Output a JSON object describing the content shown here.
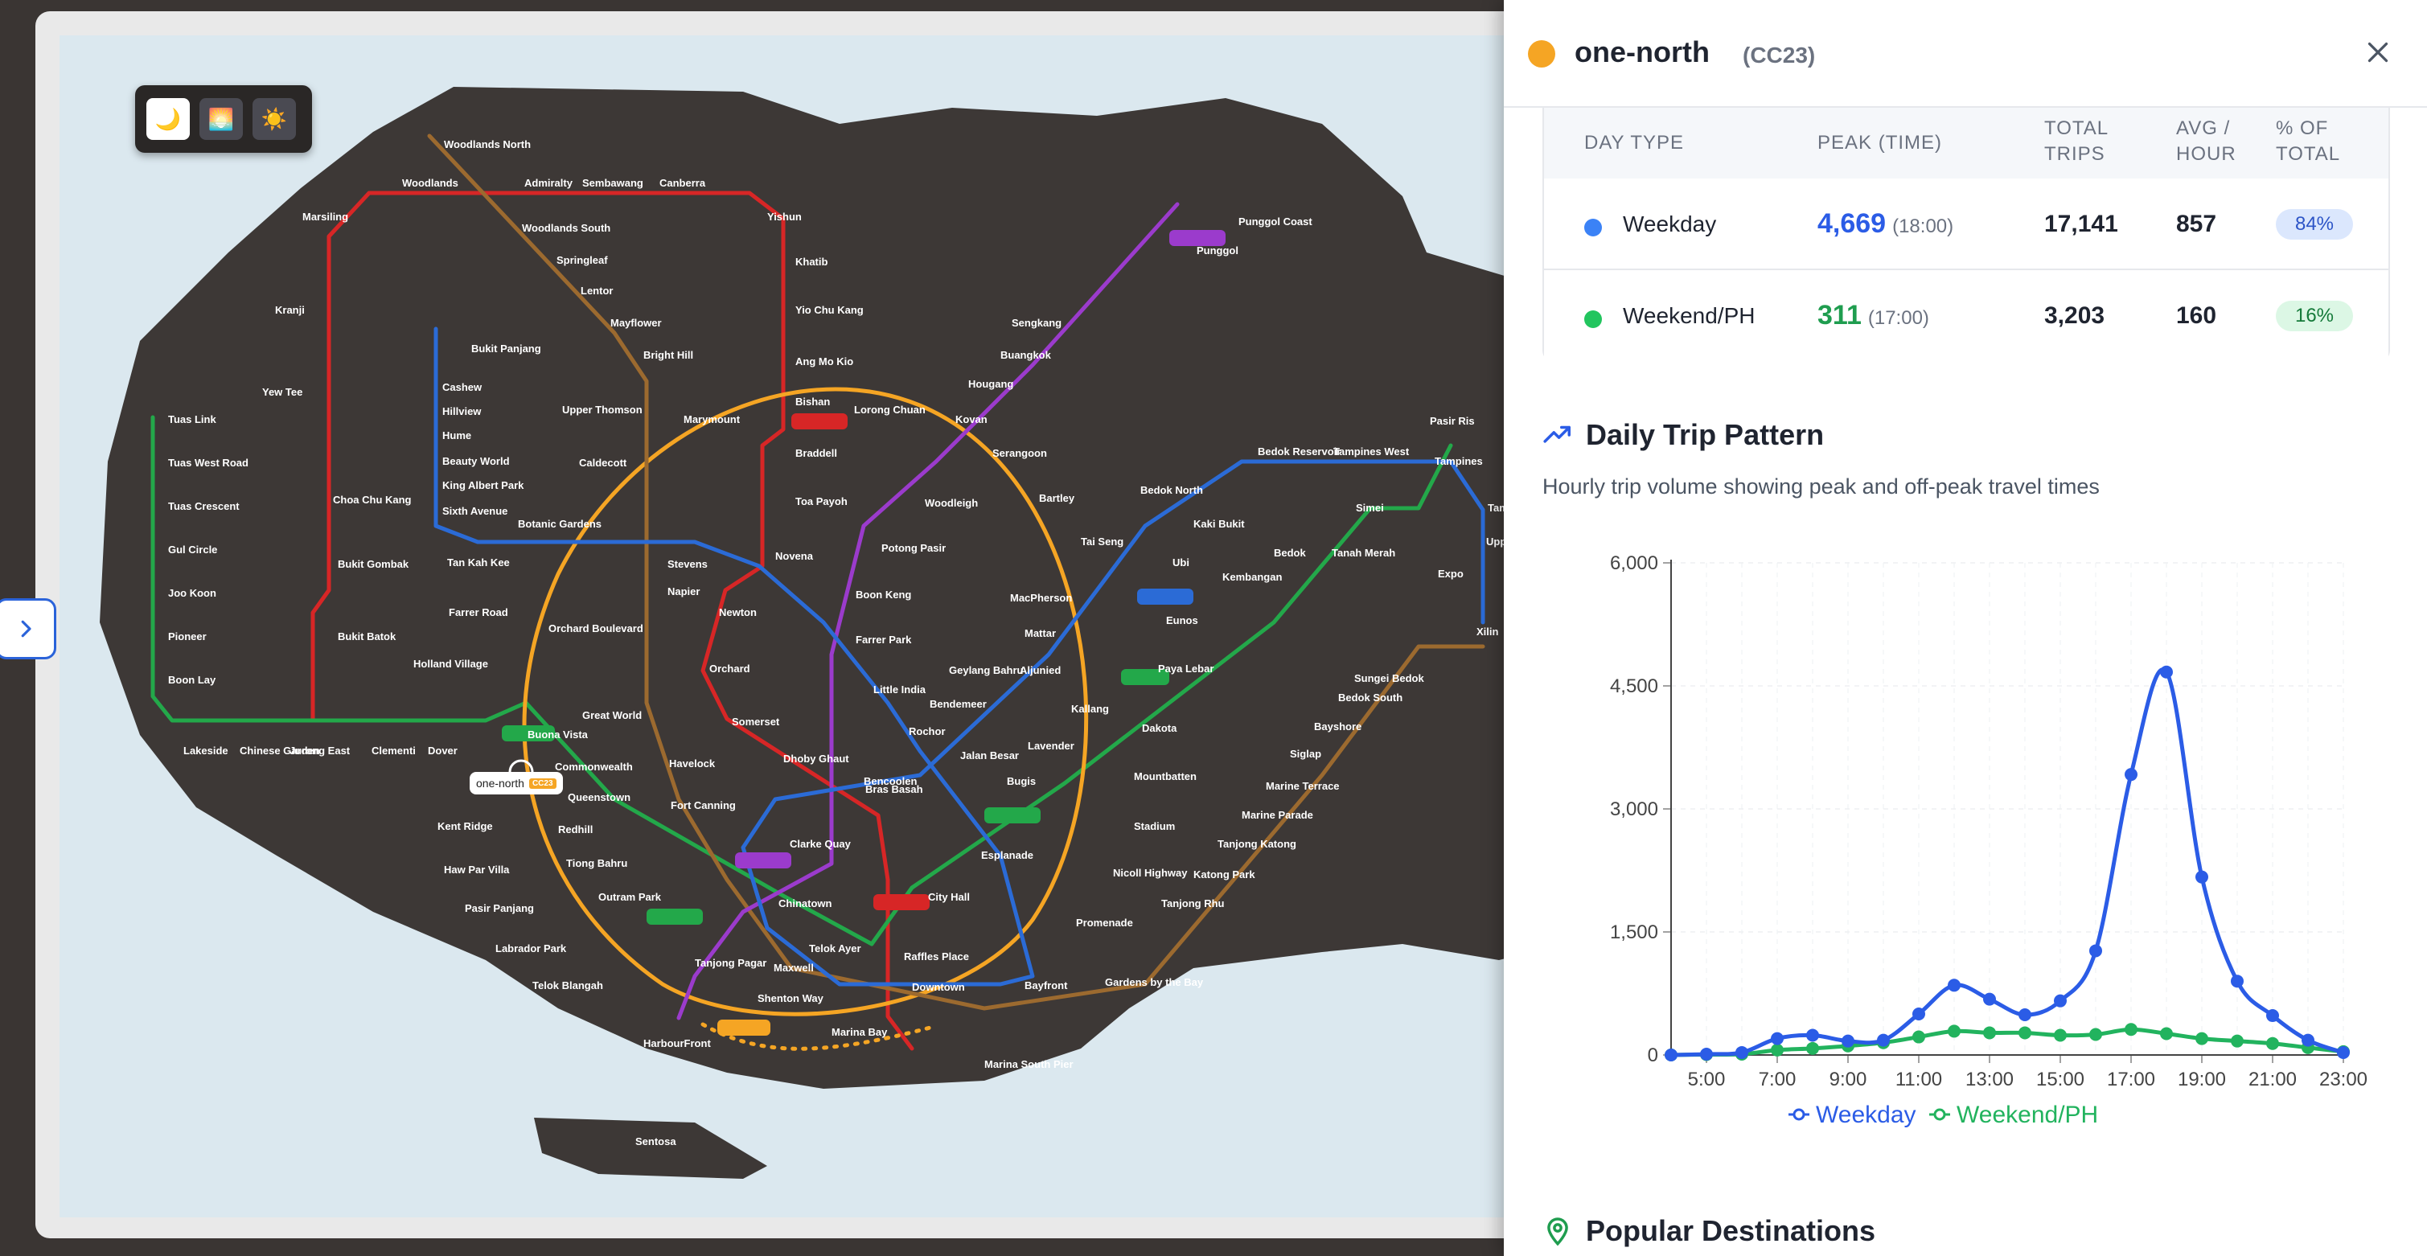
{
  "map": {
    "mode_buttons": [
      {
        "icon": "moon-icon",
        "glyph": "🌙",
        "active": true
      },
      {
        "icon": "sunset-icon",
        "glyph": "🌅",
        "active": false
      },
      {
        "icon": "sun-icon",
        "glyph": "☀️",
        "active": false
      }
    ],
    "highlight_station": {
      "name": "one-north",
      "code": "CC23"
    },
    "stations": [
      {
        "name": "Woodlands North"
      },
      {
        "name": "Woodlands"
      },
      {
        "name": "Admiralty"
      },
      {
        "name": "Sembawang"
      },
      {
        "name": "Canberra"
      },
      {
        "name": "Yishun"
      },
      {
        "name": "Khatib"
      },
      {
        "name": "Yio Chu Kang"
      },
      {
        "name": "Ang Mo Kio"
      },
      {
        "name": "Bishan"
      },
      {
        "name": "Braddell"
      },
      {
        "name": "Toa Payoh"
      },
      {
        "name": "Novena"
      },
      {
        "name": "Newton"
      },
      {
        "name": "Orchard"
      },
      {
        "name": "Somerset"
      },
      {
        "name": "Dhoby Ghaut"
      },
      {
        "name": "City Hall"
      },
      {
        "name": "Raffles Place"
      },
      {
        "name": "Marina Bay"
      },
      {
        "name": "Marina South Pier"
      },
      {
        "name": "Woodlands South"
      },
      {
        "name": "Springleaf"
      },
      {
        "name": "Lentor"
      },
      {
        "name": "Mayflower"
      },
      {
        "name": "Bright Hill"
      },
      {
        "name": "Upper Thomson"
      },
      {
        "name": "Caldecott"
      },
      {
        "name": "Stevens"
      },
      {
        "name": "Napier"
      },
      {
        "name": "Orchard Boulevard"
      },
      {
        "name": "Great World"
      },
      {
        "name": "Havelock"
      },
      {
        "name": "Outram Park"
      },
      {
        "name": "Maxwell"
      },
      {
        "name": "Shenton Way"
      },
      {
        "name": "Gardens by the Bay"
      },
      {
        "name": "Tanjong Rhu"
      },
      {
        "name": "Katong Park"
      },
      {
        "name": "Tanjong Katong"
      },
      {
        "name": "Marine Parade"
      },
      {
        "name": "Marine Terrace"
      },
      {
        "name": "Siglap"
      },
      {
        "name": "Bayshore"
      },
      {
        "name": "Bedok South"
      },
      {
        "name": "Sungei Bedok"
      },
      {
        "name": "Marsiling"
      },
      {
        "name": "Kranji"
      },
      {
        "name": "Yew Tee"
      },
      {
        "name": "Choa Chu Kang"
      },
      {
        "name": "Bukit Gombak"
      },
      {
        "name": "Bukit Batok"
      },
      {
        "name": "Jurong East"
      },
      {
        "name": "Tuas Link"
      },
      {
        "name": "Tuas West Road"
      },
      {
        "name": "Tuas Crescent"
      },
      {
        "name": "Gul Circle"
      },
      {
        "name": "Joo Koon"
      },
      {
        "name": "Pioneer"
      },
      {
        "name": "Boon Lay"
      },
      {
        "name": "Lakeside"
      },
      {
        "name": "Chinese Garden"
      },
      {
        "name": "Clementi"
      },
      {
        "name": "Dover"
      },
      {
        "name": "Buona Vista"
      },
      {
        "name": "Commonwealth"
      },
      {
        "name": "Queenstown"
      },
      {
        "name": "Redhill"
      },
      {
        "name": "Tiong Bahru"
      },
      {
        "name": "Tanjong Pagar"
      },
      {
        "name": "Bukit Panjang"
      },
      {
        "name": "Cashew"
      },
      {
        "name": "Hillview"
      },
      {
        "name": "Hume"
      },
      {
        "name": "Beauty World"
      },
      {
        "name": "King Albert Park"
      },
      {
        "name": "Sixth Avenue"
      },
      {
        "name": "Tan Kah Kee"
      },
      {
        "name": "Botanic Gardens"
      },
      {
        "name": "Farrer Road"
      },
      {
        "name": "Holland Village"
      },
      {
        "name": "Kent Ridge"
      },
      {
        "name": "Haw Par Villa"
      },
      {
        "name": "Pasir Panjang"
      },
      {
        "name": "Labrador Park"
      },
      {
        "name": "Telok Blangah"
      },
      {
        "name": "HarbourFront"
      },
      {
        "name": "Sentosa"
      },
      {
        "name": "Marymount"
      },
      {
        "name": "Lorong Chuan"
      },
      {
        "name": "Serangoon"
      },
      {
        "name": "Bartley"
      },
      {
        "name": "Tai Seng"
      },
      {
        "name": "MacPherson"
      },
      {
        "name": "Paya Lebar"
      },
      {
        "name": "Dakota"
      },
      {
        "name": "Mountbatten"
      },
      {
        "name": "Stadium"
      },
      {
        "name": "Nicoll Highway"
      },
      {
        "name": "Promenade"
      },
      {
        "name": "Esplanade"
      },
      {
        "name": "Bras Basah"
      },
      {
        "name": "Bayfront"
      },
      {
        "name": "Downtown"
      },
      {
        "name": "Telok Ayer"
      },
      {
        "name": "Chinatown"
      },
      {
        "name": "Clarke Quay"
      },
      {
        "name": "Fort Canning"
      },
      {
        "name": "Bencoolen"
      },
      {
        "name": "Jalan Besar"
      },
      {
        "name": "Bendemeer"
      },
      {
        "name": "Geylang Bahru"
      },
      {
        "name": "Mattar"
      },
      {
        "name": "Ubi"
      },
      {
        "name": "Kaki Bukit"
      },
      {
        "name": "Bedok North"
      },
      {
        "name": "Bedok Reservoir"
      },
      {
        "name": "Tampines West"
      },
      {
        "name": "Tampines"
      },
      {
        "name": "Pasir Ris"
      },
      {
        "name": "Simei"
      },
      {
        "name": "Tanah Merah"
      },
      {
        "name": "Bedok"
      },
      {
        "name": "Kembangan"
      },
      {
        "name": "Eunos"
      },
      {
        "name": "Aljunied"
      },
      {
        "name": "Kallang"
      },
      {
        "name": "Lavender"
      },
      {
        "name": "Bugis"
      },
      {
        "name": "Expo"
      },
      {
        "name": "Xilin"
      },
      {
        "name": "Upp"
      },
      {
        "name": "Tam"
      },
      {
        "name": "Rochor"
      },
      {
        "name": "Little India"
      },
      {
        "name": "Farrer Park"
      },
      {
        "name": "Boon Keng"
      },
      {
        "name": "Potong Pasir"
      },
      {
        "name": "Woodleigh"
      },
      {
        "name": "Kovan"
      },
      {
        "name": "Hougang"
      },
      {
        "name": "Buangkok"
      },
      {
        "name": "Sengkang"
      },
      {
        "name": "Punggol"
      },
      {
        "name": "Punggol Coast"
      }
    ]
  },
  "panel": {
    "line_color": "#f5a524",
    "station_name": "one-north",
    "station_code": "(CC23)",
    "table": {
      "headers": [
        "DAY TYPE",
        "PEAK (TIME)",
        "TOTAL\nTRIPS",
        "AVG /\nHOUR",
        "% OF\nTOTAL"
      ],
      "rows": [
        {
          "day_type": "Weekday",
          "color": "#3b82f6",
          "peak": "4,669",
          "peak_time": "(18:00)",
          "total": "17,141",
          "avg": "857",
          "pct": "84%",
          "pct_bg": "#dbe7fd",
          "pct_fg": "#2d55c7"
        },
        {
          "day_type": "Weekend/PH",
          "color": "#22c55e",
          "peak": "311",
          "peak_time": "(17:00)",
          "total": "3,203",
          "avg": "160",
          "pct": "16%",
          "pct_bg": "#dcf7e5",
          "pct_fg": "#157a3a"
        }
      ]
    },
    "daily_pattern": {
      "title": "Daily Trip Pattern",
      "subtitle": "Hourly trip volume showing peak and off-peak travel times"
    },
    "popular_destinations": {
      "title": "Popular Destinations"
    }
  },
  "chart_data": {
    "type": "line",
    "title": "",
    "xlabel": "",
    "ylabel": "",
    "x": [
      "4:00",
      "5:00",
      "6:00",
      "7:00",
      "8:00",
      "9:00",
      "10:00",
      "11:00",
      "12:00",
      "13:00",
      "14:00",
      "15:00",
      "16:00",
      "17:00",
      "18:00",
      "19:00",
      "20:00",
      "21:00",
      "22:00",
      "23:00"
    ],
    "x_tick_labels": [
      "5:00",
      "7:00",
      "9:00",
      "11:00",
      "13:00",
      "15:00",
      "17:00",
      "19:00",
      "21:00",
      "23:00"
    ],
    "ylim": [
      0,
      6000
    ],
    "y_ticks": [
      "0",
      "1,500",
      "3,000",
      "4,500",
      "6,000"
    ],
    "grid": true,
    "legend": "bottom",
    "series": [
      {
        "name": "Weekday",
        "color": "#2b5ce6",
        "values": [
          0,
          10,
          30,
          200,
          240,
          170,
          180,
          500,
          850,
          680,
          490,
          660,
          1270,
          3420,
          4669,
          2170,
          900,
          480,
          180,
          30
        ]
      },
      {
        "name": "Weekend/PH",
        "color": "#22b35e",
        "values": [
          0,
          5,
          10,
          60,
          80,
          110,
          150,
          220,
          290,
          270,
          270,
          240,
          250,
          311,
          260,
          200,
          170,
          140,
          90,
          40
        ]
      }
    ]
  }
}
